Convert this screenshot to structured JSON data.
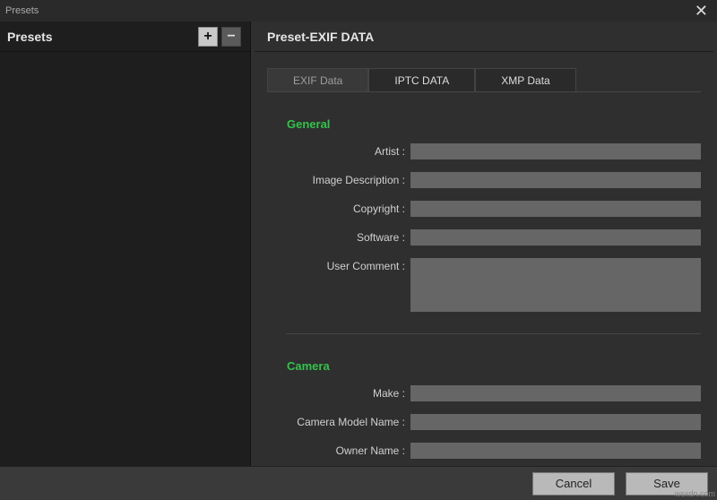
{
  "window": {
    "title": "Presets"
  },
  "sidebar": {
    "title": "Presets",
    "add_glyph": "+",
    "remove_glyph": "−"
  },
  "main": {
    "title": "Preset-EXIF DATA",
    "tabs": [
      {
        "label": "EXIF Data",
        "active": true
      },
      {
        "label": "IPTC DATA",
        "active": false
      },
      {
        "label": "XMP Data",
        "active": false
      }
    ],
    "sections": {
      "general": {
        "title": "General",
        "fields": {
          "artist": {
            "label": "Artist :",
            "value": ""
          },
          "image_description": {
            "label": "Image Description :",
            "value": ""
          },
          "copyright": {
            "label": "Copyright :",
            "value": ""
          },
          "software": {
            "label": "Software :",
            "value": ""
          },
          "user_comment": {
            "label": "User Comment :",
            "value": ""
          }
        }
      },
      "camera": {
        "title": "Camera",
        "fields": {
          "make": {
            "label": "Make :",
            "value": ""
          },
          "model_name": {
            "label": "Camera Model Name :",
            "value": ""
          },
          "owner_name": {
            "label": "Owner Name :",
            "value": ""
          }
        }
      }
    }
  },
  "footer": {
    "cancel": "Cancel",
    "save": "Save"
  },
  "watermark": "wsxdn.com"
}
